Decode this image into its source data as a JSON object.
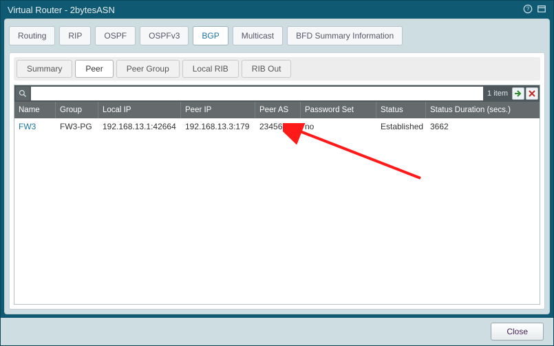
{
  "title": "Virtual Router - 2bytesASN",
  "primary_tabs": {
    "routing": "Routing",
    "rip": "RIP",
    "ospf": "OSPF",
    "ospfv3": "OSPFv3",
    "bgp": "BGP",
    "multicast": "Multicast",
    "bfd": "BFD Summary Information"
  },
  "active_primary": "bgp",
  "sub_tabs": {
    "summary": "Summary",
    "peer": "Peer",
    "peergroup": "Peer Group",
    "localrib": "Local RIB",
    "ribout": "RIB Out"
  },
  "active_sub": "peer",
  "search": {
    "placeholder": "",
    "value": ""
  },
  "items_count_label": "1 item",
  "columns": {
    "name": "Name",
    "group": "Group",
    "lip": "Local IP",
    "pip": "Peer IP",
    "pas": "Peer AS",
    "pwd": "Password Set",
    "stat": "Status",
    "dur": "Status Duration (secs.)"
  },
  "rows": [
    {
      "name": "FW3",
      "group": "FW3-PG",
      "lip": "192.168.13.1:42664",
      "pip": "192.168.13.3:179",
      "pas": "23456",
      "pwd": "no",
      "stat": "Established",
      "dur": "3662"
    }
  ],
  "close_label": "Close"
}
